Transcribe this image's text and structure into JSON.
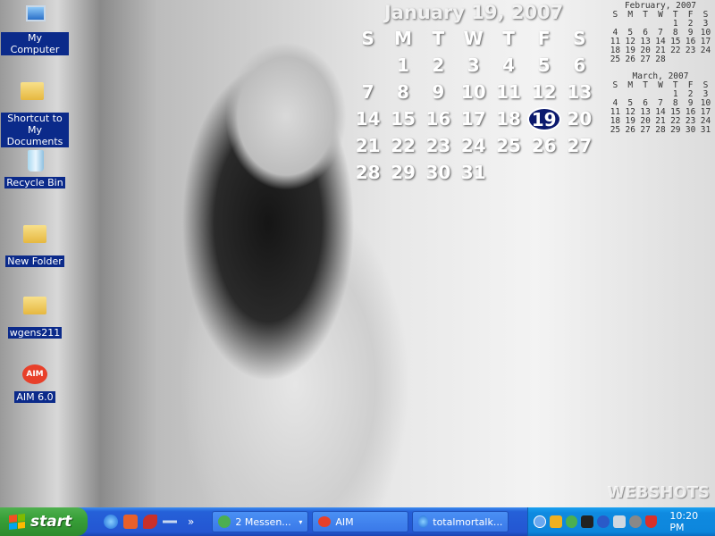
{
  "desktop_icons": [
    {
      "label": "My Computer",
      "icon": "computer-icon"
    },
    {
      "label": "Shortcut to My Documents",
      "icon": "documents-icon"
    },
    {
      "label": "Recycle Bin",
      "icon": "recycle-bin-icon"
    },
    {
      "label": "New Folder",
      "icon": "folder-icon"
    },
    {
      "label": "wgens211",
      "icon": "folder-icon"
    },
    {
      "label": "AIM 6.0",
      "icon": "aim-icon"
    }
  ],
  "calendar": {
    "title": "January 19, 2007",
    "weekdays": [
      "S",
      "M",
      "T",
      "W",
      "T",
      "F",
      "S"
    ],
    "weeks": [
      [
        "",
        "1",
        "2",
        "3",
        "4",
        "5",
        "6"
      ],
      [
        "7",
        "8",
        "9",
        "10",
        "11",
        "12",
        "13"
      ],
      [
        "14",
        "15",
        "16",
        "17",
        "18",
        "19",
        "20"
      ],
      [
        "21",
        "22",
        "23",
        "24",
        "25",
        "26",
        "27"
      ],
      [
        "28",
        "29",
        "30",
        "31",
        "",
        "",
        ""
      ]
    ],
    "today": "19"
  },
  "mini_calendars": [
    {
      "title": "February, 2007",
      "weekdays": [
        "S",
        "M",
        "T",
        "W",
        "T",
        "F",
        "S"
      ],
      "weeks": [
        [
          "",
          "",
          "",
          "",
          "1",
          "2",
          "3"
        ],
        [
          "4",
          "5",
          "6",
          "7",
          "8",
          "9",
          "10"
        ],
        [
          "11",
          "12",
          "13",
          "14",
          "15",
          "16",
          "17"
        ],
        [
          "18",
          "19",
          "20",
          "21",
          "22",
          "23",
          "24"
        ],
        [
          "25",
          "26",
          "27",
          "28",
          "",
          "",
          ""
        ]
      ]
    },
    {
      "title": "March, 2007",
      "weekdays": [
        "S",
        "M",
        "T",
        "W",
        "T",
        "F",
        "S"
      ],
      "weeks": [
        [
          "",
          "",
          "",
          "",
          "1",
          "2",
          "3"
        ],
        [
          "4",
          "5",
          "6",
          "7",
          "8",
          "9",
          "10"
        ],
        [
          "11",
          "12",
          "13",
          "14",
          "15",
          "16",
          "17"
        ],
        [
          "18",
          "19",
          "20",
          "21",
          "22",
          "23",
          "24"
        ],
        [
          "25",
          "26",
          "27",
          "28",
          "29",
          "30",
          "31"
        ]
      ]
    }
  ],
  "watermark": "WEBSHOTS",
  "taskbar": {
    "start_label": "start",
    "quick_launch": [
      "internet-explorer-icon",
      "mail-icon",
      "media-icon",
      "show-desktop-icon"
    ],
    "overflow": "»",
    "buttons": [
      {
        "label": "2 Messen...",
        "icon": "messenger-icon"
      },
      {
        "label": "AIM",
        "icon": "aim-icon"
      },
      {
        "label": "totalmortalk...",
        "icon": "internet-explorer-icon"
      }
    ],
    "clock": "10:20 PM"
  }
}
